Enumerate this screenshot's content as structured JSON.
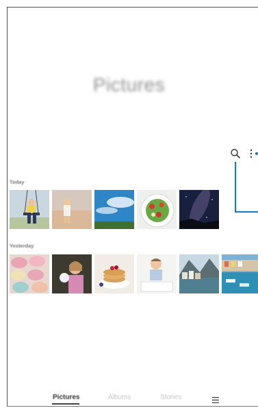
{
  "title": "Pictures",
  "toolbar": {
    "search_icon": "search-icon",
    "more_icon": "more-options-icon"
  },
  "sections": [
    {
      "label": "Today",
      "items": [
        "swing-kid",
        "beach-child",
        "blue-sky",
        "salad-plate",
        "night-sky"
      ]
    },
    {
      "label": "Yesterday",
      "items": [
        "macarons",
        "girl-with-flower",
        "pancakes-berries",
        "toddler-drawing",
        "lakeside-village",
        "harbor-boats"
      ]
    }
  ],
  "bottom_nav": {
    "tabs": [
      {
        "label": "Pictures",
        "active": true
      },
      {
        "label": "Albums",
        "active": false
      },
      {
        "label": "Stories",
        "active": false
      }
    ],
    "menu_icon": "hamburger-menu-icon"
  },
  "colors": {
    "callout": "#1477c8",
    "active_tab": "#333333",
    "inactive_tab": "#c2c2c2"
  }
}
